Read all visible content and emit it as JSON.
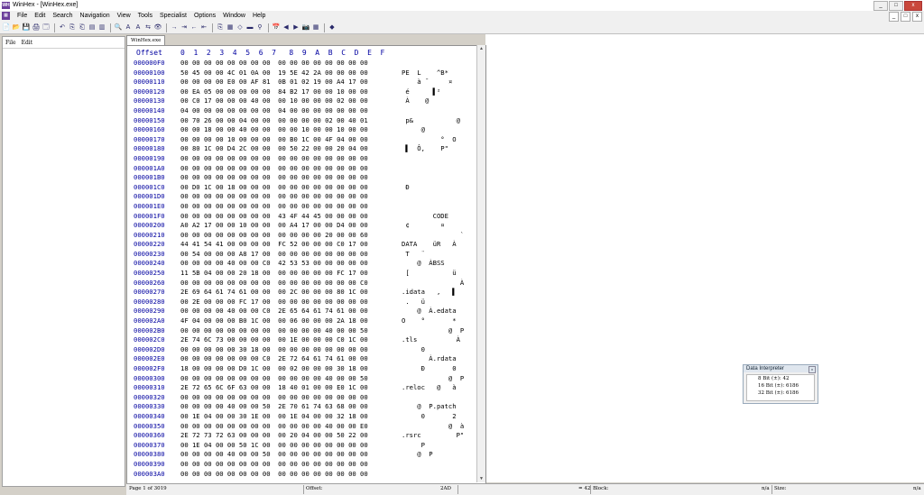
{
  "window": {
    "title": "WinHex - [WinHex.exe]",
    "app_icon_text": "WH",
    "min": "_",
    "max": "□",
    "close": "x"
  },
  "menu": {
    "items": [
      "File",
      "Edit",
      "Search",
      "Navigation",
      "View",
      "Tools",
      "Specialist",
      "Options",
      "Window",
      "Help"
    ]
  },
  "toolbar": {
    "icons": [
      "📄",
      "📂",
      "💾",
      "🖨",
      "🗔",
      "|",
      "↶",
      "⎘",
      "⎗",
      "▤",
      "▥",
      "|",
      "🔍",
      "A",
      "A",
      "⇆",
      "👁",
      "|",
      "→",
      "⇥",
      "←",
      "⇤",
      "|",
      "⎘",
      "▦",
      "◇",
      "▬",
      "⚲",
      "|",
      "📅",
      "◀",
      "▶",
      "📷",
      "▦",
      "|",
      "◆"
    ]
  },
  "left_pane": {
    "menu": [
      "File",
      "Edit"
    ]
  },
  "tab": {
    "label": "WinHex.exe"
  },
  "hex": {
    "offset_header": "Offset",
    "col_header": "0  1  2  3  4  5  6  7   8  9  A  B  C  D  E  F",
    "rows": [
      {
        "offset": "000000F0",
        "hex": "00 00 00 00 00 00 00 00  00 00 00 00 00 00 00 00",
        "ascii": ""
      },
      {
        "offset": "00000100",
        "hex": "50 45 00 00 4C 01 0A 00  19 5E 42 2A 00 00 00 00",
        "ascii": "PE  L    ^B*"
      },
      {
        "offset": "00000110",
        "hex": "00 00 00 00 E0 00 AF 81  0B 01 02 19 00 A4 17 00",
        "ascii": "    à ¯     ¤"
      },
      {
        "offset": "00000120",
        "hex": "00 EA 05 00 00 00 00 00  84 B2 17 00 00 10 00 00",
        "ascii": " é      ▌²"
      },
      {
        "offset": "00000130",
        "hex": "00 C0 17 00 00 00 40 00  00 10 00 00 00 02 00 00",
        "ascii": " À    @"
      },
      {
        "offset": "00000140",
        "hex": "04 00 00 00 00 00 00 00  04 00 00 00 00 00 00 00",
        "ascii": ""
      },
      {
        "offset": "00000150",
        "hex": "00 70 26 00 00 04 00 00  00 00 00 00 02 00 40 01",
        "ascii": " p&           @"
      },
      {
        "offset": "00000160",
        "hex": "00 00 18 00 00 40 00 00  00 00 10 00 00 10 00 00",
        "ascii": "     @"
      },
      {
        "offset": "00000170",
        "hex": "00 00 00 00 10 00 00 00  00 B0 1C 00 4F 04 00 00",
        "ascii": "          °  O"
      },
      {
        "offset": "00000180",
        "hex": "00 80 1C 00 D4 2C 00 00  00 50 22 00 00 20 04 00",
        "ascii": " ▌  Ô,    P\""
      },
      {
        "offset": "00000190",
        "hex": "00 00 00 00 00 00 00 00  00 00 00 00 00 00 00 00",
        "ascii": ""
      },
      {
        "offset": "000001A0",
        "hex": "00 00 00 00 00 00 00 00  00 00 00 00 00 00 00 00",
        "ascii": ""
      },
      {
        "offset": "000001B0",
        "hex": "00 00 00 00 00 00 00 00  00 00 00 00 00 00 00 00",
        "ascii": ""
      },
      {
        "offset": "000001C0",
        "hex": "00 D0 1C 00 18 00 00 00  00 00 00 00 00 00 00 00",
        "ascii": " Ð"
      },
      {
        "offset": "000001D0",
        "hex": "00 00 00 00 00 00 00 00  00 00 00 00 00 00 00 00",
        "ascii": ""
      },
      {
        "offset": "000001E0",
        "hex": "00 00 00 00 00 00 00 00  00 00 00 00 00 00 00 00",
        "ascii": ""
      },
      {
        "offset": "000001F0",
        "hex": "00 00 00 00 00 00 00 00  43 4F 44 45 00 00 00 00",
        "ascii": "        CODE"
      },
      {
        "offset": "00000200",
        "hex": "A0 A2 17 00 00 10 00 00  00 A4 17 00 00 D4 00 00",
        "ascii": " ¢        ¤"
      },
      {
        "offset": "00000210",
        "hex": "00 00 00 00 00 00 00 00  00 00 00 00 20 00 00 60",
        "ascii": "               `"
      },
      {
        "offset": "00000220",
        "hex": "44 41 54 41 00 00 00 00  FC 52 00 00 00 C0 17 00",
        "ascii": "DATA    üR   À"
      },
      {
        "offset": "00000230",
        "hex": "00 54 00 00 00 A8 17 00  00 00 00 00 00 00 00 00",
        "ascii": " T   ¨"
      },
      {
        "offset": "00000240",
        "hex": "00 00 00 00 40 00 00 C0  42 53 53 00 00 00 00 00",
        "ascii": "    @  ÀBSS"
      },
      {
        "offset": "00000250",
        "hex": "11 5B 04 00 00 20 18 00  00 00 00 00 00 FC 17 00",
        "ascii": " [           ü"
      },
      {
        "offset": "00000260",
        "hex": "00 00 00 00 00 00 00 00  00 00 00 00 00 00 00 C0",
        "ascii": "               À"
      },
      {
        "offset": "00000270",
        "hex": "2E 69 64 61 74 61 00 00  00 2C 00 00 00 80 1C 00",
        "ascii": ".idata   ,   ▌"
      },
      {
        "offset": "00000280",
        "hex": "00 2E 00 00 00 FC 17 00  00 00 00 00 00 00 00 00",
        "ascii": " .   ü"
      },
      {
        "offset": "00000290",
        "hex": "00 00 00 00 40 00 00 C0  2E 65 64 61 74 61 00 00",
        "ascii": "    @  À.edata"
      },
      {
        "offset": "000002A0",
        "hex": "4F 04 00 00 00 B0 1C 00  00 06 00 00 00 2A 18 00",
        "ascii": "O    °       *"
      },
      {
        "offset": "000002B0",
        "hex": "00 00 00 00 00 00 00 00  00 00 00 00 40 00 00 50",
        "ascii": "            @  P"
      },
      {
        "offset": "000002C0",
        "hex": "2E 74 6C 73 00 00 00 00  00 1E 00 00 00 C0 1C 00",
        "ascii": ".tls          À"
      },
      {
        "offset": "000002D0",
        "hex": "00 00 00 00 00 30 18 00  00 00 00 00 00 00 00 00",
        "ascii": "     0"
      },
      {
        "offset": "000002E0",
        "hex": "00 00 00 00 00 00 00 C0  2E 72 64 61 74 61 00 00",
        "ascii": "       À.rdata"
      },
      {
        "offset": "000002F0",
        "hex": "18 00 00 00 00 D0 1C 00  00 02 00 00 00 30 18 00",
        "ascii": "     Ð       0"
      },
      {
        "offset": "00000300",
        "hex": "00 00 00 00 00 00 00 00  00 00 00 00 40 00 00 50",
        "ascii": "            @  P"
      },
      {
        "offset": "00000310",
        "hex": "2E 72 65 6C 6F 63 00 00  18 40 01 00 00 E0 1C 00",
        "ascii": ".reloc   @   à"
      },
      {
        "offset": "00000320",
        "hex": "00 00 00 00 00 00 00 00  00 00 00 00 00 00 00 00",
        "ascii": ""
      },
      {
        "offset": "00000330",
        "hex": "00 00 00 00 40 00 00 50  2E 70 61 74 63 68 00 00",
        "ascii": "    @  P.patch"
      },
      {
        "offset": "00000340",
        "hex": "00 1E 04 00 00 30 1E 00  00 1E 04 00 00 32 18 00",
        "ascii": "     0       2"
      },
      {
        "offset": "00000350",
        "hex": "00 00 00 00 00 00 00 00  00 00 00 00 40 00 00 E0",
        "ascii": "            @  à"
      },
      {
        "offset": "00000360",
        "hex": "2E 72 73 72 63 00 00 00  00 20 04 00 00 50 22 00",
        "ascii": ".rsrc         P\""
      },
      {
        "offset": "00000370",
        "hex": "00 1E 04 00 00 50 1C 00  00 00 00 00 00 00 00 00",
        "ascii": "     P"
      },
      {
        "offset": "00000380",
        "hex": "00 00 00 00 40 00 00 50  00 00 00 00 00 00 00 00",
        "ascii": "    @  P"
      },
      {
        "offset": "00000390",
        "hex": "00 00 00 00 00 00 00 00  00 00 00 00 00 00 00 00",
        "ascii": ""
      },
      {
        "offset": "000003A0",
        "hex": "00 00 00 00 00 00 00 00  00 00 00 00 00 00 00 00",
        "ascii": ""
      }
    ]
  },
  "data_interpreter": {
    "title": "Data Interpreter",
    "lines": [
      "8 Bit (±): 42",
      "16 Bit (±): 6186",
      "32 Bit (±): 6186"
    ]
  },
  "status": {
    "page": "Page 1 of 3019",
    "offset_label": "Offset:",
    "offset_value": "2AD",
    "value": "= 42",
    "block_label": "Block:",
    "block_value": "n/a",
    "size_label": "Size:",
    "size_value": "n/a"
  }
}
